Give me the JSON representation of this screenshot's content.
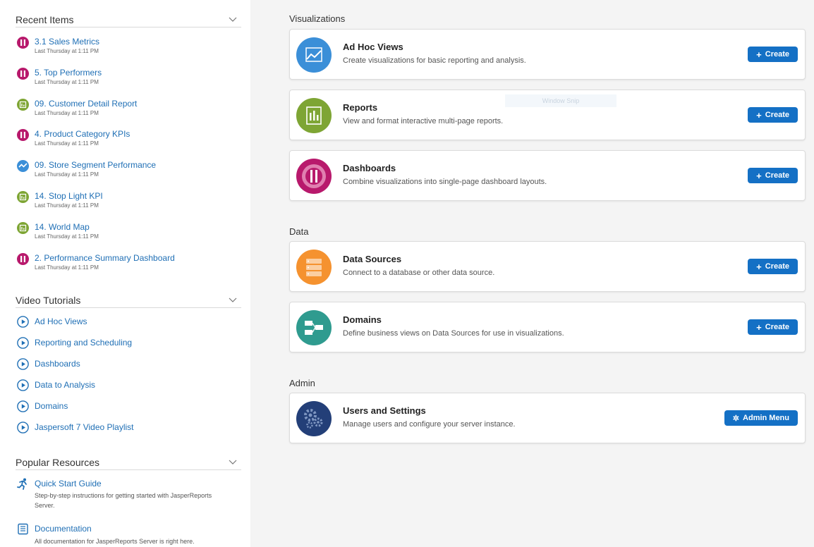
{
  "recent": {
    "title": "Recent Items",
    "items": [
      {
        "title": "3.1 Sales Metrics",
        "meta": "Last Thursday at 1:11 PM",
        "icon": "dashboard-icon"
      },
      {
        "title": "5. Top Performers",
        "meta": "Last Thursday at 1:11 PM",
        "icon": "dashboard-icon"
      },
      {
        "title": "09. Customer Detail Report",
        "meta": "Last Thursday at 1:11 PM",
        "icon": "report-icon"
      },
      {
        "title": "4. Product Category KPIs",
        "meta": "Last Thursday at 1:11 PM",
        "icon": "dashboard-icon"
      },
      {
        "title": "09. Store Segment Performance",
        "meta": "Last Thursday at 1:11 PM",
        "icon": "adhoc-view-icon"
      },
      {
        "title": "14. Stop Light KPI",
        "meta": "Last Thursday at 1:11 PM",
        "icon": "report-icon"
      },
      {
        "title": "14. World Map",
        "meta": "Last Thursday at 1:11 PM",
        "icon": "report-icon"
      },
      {
        "title": "2. Performance Summary Dashboard",
        "meta": "Last Thursday at 1:11 PM",
        "icon": "dashboard-icon"
      }
    ]
  },
  "videos": {
    "title": "Video Tutorials",
    "items": [
      "Ad Hoc Views",
      "Reporting and Scheduling",
      "Dashboards",
      "Data to Analysis",
      "Domains",
      "Jaspersoft 7 Video Playlist"
    ]
  },
  "resources": {
    "title": "Popular Resources",
    "items": [
      {
        "title": "Quick Start Guide",
        "desc": "Step-by-step instructions for getting started with JasperReports Server.",
        "icon": "runner-icon"
      },
      {
        "title": "Documentation",
        "desc": "All documentation for JasperReports Server is right here.",
        "icon": "document-icon"
      }
    ]
  },
  "sections": {
    "visualizations": "Visualizations",
    "data": "Data",
    "admin": "Admin"
  },
  "cards": {
    "adhoc": {
      "title": "Ad Hoc Views",
      "desc": "Create visualizations for basic reporting and analysis.",
      "button": "Create",
      "color": "#3b8fd8"
    },
    "reports": {
      "title": "Reports",
      "desc": "View and format interactive multi-page reports.",
      "button": "Create",
      "color": "#7ea534"
    },
    "dashboards": {
      "title": "Dashboards",
      "desc": "Combine visualizations into single-page dashboard layouts.",
      "button": "Create",
      "color": "#b8196c"
    },
    "datasources": {
      "title": "Data Sources",
      "desc": "Connect to a database or other data source.",
      "button": "Create",
      "color": "#f5922f"
    },
    "domains": {
      "title": "Domains",
      "desc": "Define business views on Data Sources for use in visualizations.",
      "button": "Create",
      "color": "#2f9b8f"
    },
    "users": {
      "title": "Users and Settings",
      "desc": "Manage users and configure your server instance.",
      "button": "Admin Menu",
      "color": "#233f78"
    }
  },
  "overlay": {
    "snip": "Window Snip"
  },
  "colors": {
    "link": "#1f6fb5",
    "button": "#1470c5"
  }
}
